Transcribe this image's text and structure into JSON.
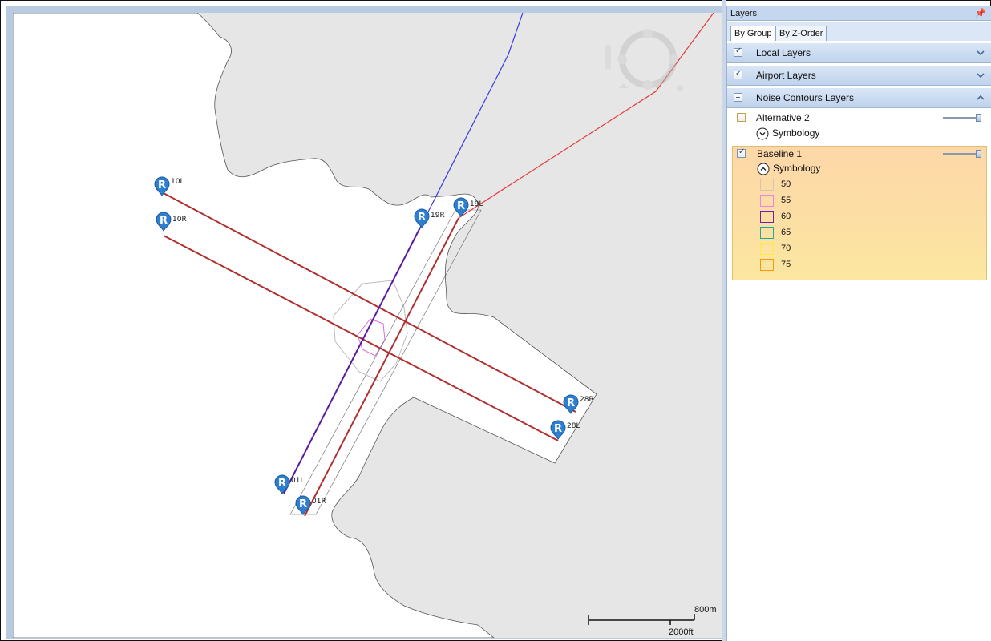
{
  "panel": {
    "title": "Layers",
    "pin_icon": "pin-icon",
    "tabs": [
      {
        "label": "By Group",
        "active": true
      },
      {
        "label": "By Z-Order",
        "active": false
      }
    ],
    "groups": {
      "local": {
        "label": "Local Layers",
        "checked": true,
        "expanded": false
      },
      "airport": {
        "label": "Airport Layers",
        "checked": true,
        "expanded": false
      },
      "noise": {
        "label": "Noise Contours Layers",
        "checked": "partial",
        "expanded": true
      }
    },
    "layers": {
      "alternative": {
        "name": "Alternative 2",
        "checked": false,
        "symbology_label": "Symbology",
        "symbology_expanded": false
      },
      "baseline": {
        "name": "Baseline 1",
        "checked": true,
        "symbology_label": "Symbology",
        "symbology_expanded": true,
        "legend": [
          {
            "label": "50",
            "color": "#d8c4b0"
          },
          {
            "label": "55",
            "color": "#ee82ee"
          },
          {
            "label": "60",
            "color": "#7b1fa2"
          },
          {
            "label": "65",
            "color": "#26a69a"
          },
          {
            "label": "70",
            "color": "#ffeb3b"
          },
          {
            "label": "75",
            "color": "#ff9800"
          }
        ]
      }
    }
  },
  "map": {
    "runways": [
      {
        "label": "10L"
      },
      {
        "label": "10R"
      },
      {
        "label": "19R"
      },
      {
        "label": "19L"
      },
      {
        "label": "28R"
      },
      {
        "label": "28L"
      },
      {
        "label": "01L"
      },
      {
        "label": "01R"
      }
    ],
    "marker_letter": "R",
    "scale": {
      "metric": "800m",
      "imperial": "2000ft"
    },
    "colors": {
      "land": "#e6e6e6",
      "water": "#ffffff",
      "runway_line": "#b03030",
      "flight_blue": "#3a3ae6",
      "flight_red": "#e23a3a",
      "marker": "#2f7fd0"
    }
  }
}
